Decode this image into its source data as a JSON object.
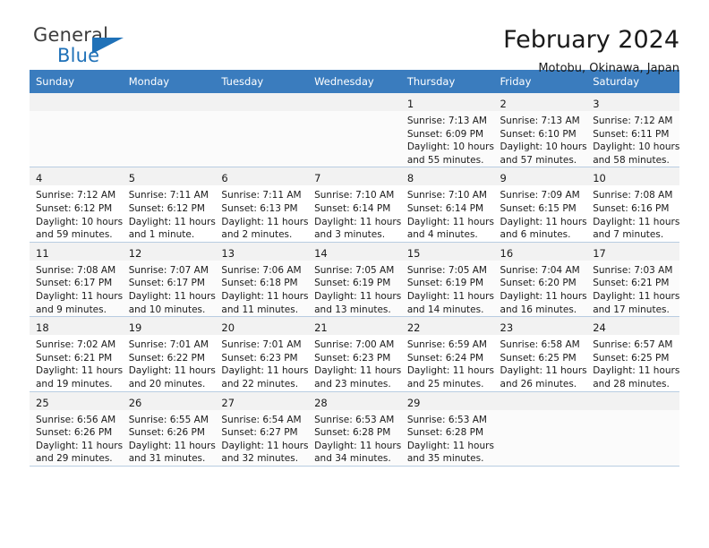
{
  "brand": {
    "name_part1": "General",
    "name_part2": "Blue",
    "logo_color": "#1f71b8"
  },
  "header": {
    "title": "February 2024",
    "subtitle": "Motobu, Okinawa, Japan"
  },
  "theme": {
    "header_row_bg": "#3a7cbe",
    "header_row_text": "#ffffff",
    "row_border": "#b9cde2",
    "shaded_cell_bg": "#f2f2f2"
  },
  "weekday_headers": [
    "Sunday",
    "Monday",
    "Tuesday",
    "Wednesday",
    "Thursday",
    "Friday",
    "Saturday"
  ],
  "weeks": [
    [
      {
        "day": "",
        "lines": []
      },
      {
        "day": "",
        "lines": []
      },
      {
        "day": "",
        "lines": []
      },
      {
        "day": "",
        "lines": []
      },
      {
        "day": "1",
        "lines": [
          "Sunrise: 7:13 AM",
          "Sunset: 6:09 PM",
          "Daylight: 10 hours",
          "and 55 minutes."
        ]
      },
      {
        "day": "2",
        "lines": [
          "Sunrise: 7:13 AM",
          "Sunset: 6:10 PM",
          "Daylight: 10 hours",
          "and 57 minutes."
        ]
      },
      {
        "day": "3",
        "lines": [
          "Sunrise: 7:12 AM",
          "Sunset: 6:11 PM",
          "Daylight: 10 hours",
          "and 58 minutes."
        ]
      }
    ],
    [
      {
        "day": "4",
        "lines": [
          "Sunrise: 7:12 AM",
          "Sunset: 6:12 PM",
          "Daylight: 10 hours",
          "and 59 minutes."
        ]
      },
      {
        "day": "5",
        "lines": [
          "Sunrise: 7:11 AM",
          "Sunset: 6:12 PM",
          "Daylight: 11 hours",
          "and 1 minute."
        ]
      },
      {
        "day": "6",
        "lines": [
          "Sunrise: 7:11 AM",
          "Sunset: 6:13 PM",
          "Daylight: 11 hours",
          "and 2 minutes."
        ]
      },
      {
        "day": "7",
        "lines": [
          "Sunrise: 7:10 AM",
          "Sunset: 6:14 PM",
          "Daylight: 11 hours",
          "and 3 minutes."
        ]
      },
      {
        "day": "8",
        "lines": [
          "Sunrise: 7:10 AM",
          "Sunset: 6:14 PM",
          "Daylight: 11 hours",
          "and 4 minutes."
        ]
      },
      {
        "day": "9",
        "lines": [
          "Sunrise: 7:09 AM",
          "Sunset: 6:15 PM",
          "Daylight: 11 hours",
          "and 6 minutes."
        ]
      },
      {
        "day": "10",
        "lines": [
          "Sunrise: 7:08 AM",
          "Sunset: 6:16 PM",
          "Daylight: 11 hours",
          "and 7 minutes."
        ]
      }
    ],
    [
      {
        "day": "11",
        "lines": [
          "Sunrise: 7:08 AM",
          "Sunset: 6:17 PM",
          "Daylight: 11 hours",
          "and 9 minutes."
        ]
      },
      {
        "day": "12",
        "lines": [
          "Sunrise: 7:07 AM",
          "Sunset: 6:17 PM",
          "Daylight: 11 hours",
          "and 10 minutes."
        ]
      },
      {
        "day": "13",
        "lines": [
          "Sunrise: 7:06 AM",
          "Sunset: 6:18 PM",
          "Daylight: 11 hours",
          "and 11 minutes."
        ]
      },
      {
        "day": "14",
        "lines": [
          "Sunrise: 7:05 AM",
          "Sunset: 6:19 PM",
          "Daylight: 11 hours",
          "and 13 minutes."
        ]
      },
      {
        "day": "15",
        "lines": [
          "Sunrise: 7:05 AM",
          "Sunset: 6:19 PM",
          "Daylight: 11 hours",
          "and 14 minutes."
        ]
      },
      {
        "day": "16",
        "lines": [
          "Sunrise: 7:04 AM",
          "Sunset: 6:20 PM",
          "Daylight: 11 hours",
          "and 16 minutes."
        ]
      },
      {
        "day": "17",
        "lines": [
          "Sunrise: 7:03 AM",
          "Sunset: 6:21 PM",
          "Daylight: 11 hours",
          "and 17 minutes."
        ]
      }
    ],
    [
      {
        "day": "18",
        "lines": [
          "Sunrise: 7:02 AM",
          "Sunset: 6:21 PM",
          "Daylight: 11 hours",
          "and 19 minutes."
        ]
      },
      {
        "day": "19",
        "lines": [
          "Sunrise: 7:01 AM",
          "Sunset: 6:22 PM",
          "Daylight: 11 hours",
          "and 20 minutes."
        ]
      },
      {
        "day": "20",
        "lines": [
          "Sunrise: 7:01 AM",
          "Sunset: 6:23 PM",
          "Daylight: 11 hours",
          "and 22 minutes."
        ]
      },
      {
        "day": "21",
        "lines": [
          "Sunrise: 7:00 AM",
          "Sunset: 6:23 PM",
          "Daylight: 11 hours",
          "and 23 minutes."
        ]
      },
      {
        "day": "22",
        "lines": [
          "Sunrise: 6:59 AM",
          "Sunset: 6:24 PM",
          "Daylight: 11 hours",
          "and 25 minutes."
        ]
      },
      {
        "day": "23",
        "lines": [
          "Sunrise: 6:58 AM",
          "Sunset: 6:25 PM",
          "Daylight: 11 hours",
          "and 26 minutes."
        ]
      },
      {
        "day": "24",
        "lines": [
          "Sunrise: 6:57 AM",
          "Sunset: 6:25 PM",
          "Daylight: 11 hours",
          "and 28 minutes."
        ]
      }
    ],
    [
      {
        "day": "25",
        "lines": [
          "Sunrise: 6:56 AM",
          "Sunset: 6:26 PM",
          "Daylight: 11 hours",
          "and 29 minutes."
        ]
      },
      {
        "day": "26",
        "lines": [
          "Sunrise: 6:55 AM",
          "Sunset: 6:26 PM",
          "Daylight: 11 hours",
          "and 31 minutes."
        ]
      },
      {
        "day": "27",
        "lines": [
          "Sunrise: 6:54 AM",
          "Sunset: 6:27 PM",
          "Daylight: 11 hours",
          "and 32 minutes."
        ]
      },
      {
        "day": "28",
        "lines": [
          "Sunrise: 6:53 AM",
          "Sunset: 6:28 PM",
          "Daylight: 11 hours",
          "and 34 minutes."
        ]
      },
      {
        "day": "29",
        "lines": [
          "Sunrise: 6:53 AM",
          "Sunset: 6:28 PM",
          "Daylight: 11 hours",
          "and 35 minutes."
        ]
      },
      {
        "day": "",
        "lines": []
      },
      {
        "day": "",
        "lines": []
      }
    ]
  ]
}
